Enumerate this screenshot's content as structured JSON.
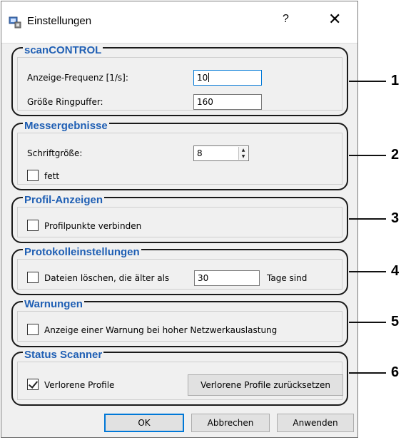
{
  "window": {
    "title": "Einstellungen",
    "help_label": "?",
    "close_label": "✕"
  },
  "groups": {
    "scancontrol": {
      "title": "scanCONTROL",
      "frequency_label": "Anzeige-Frequenz [1/s]:",
      "frequency_value": "10",
      "buffer_label": "Größe Ringpuffer:",
      "buffer_value": "160"
    },
    "messergebnisse": {
      "title": "Messergebnisse",
      "fontsize_label": "Schriftgröße:",
      "fontsize_value": "8",
      "bold_label": "fett",
      "bold_checked": false
    },
    "profil": {
      "title": "Profil-Anzeigen",
      "connect_label": "Profilpunkte verbinden",
      "connect_checked": false
    },
    "protokoll": {
      "title": "Protokolleinstellungen",
      "delete_label": "Dateien löschen, die älter als",
      "days_value": "30",
      "days_suffix": "Tage sind",
      "delete_checked": false
    },
    "warnungen": {
      "title": "Warnungen",
      "warn_label": "Anzeige einer Warnung bei hoher Netzwerkauslastung",
      "warn_checked": false
    },
    "status": {
      "title": "Status Scanner",
      "lost_label": "Verlorene Profile",
      "lost_checked": true,
      "reset_label": "Verlorene Profile zurücksetzen"
    }
  },
  "buttons": {
    "ok": "OK",
    "cancel": "Abbrechen",
    "apply": "Anwenden"
  },
  "callouts": [
    "1",
    "2",
    "3",
    "4",
    "5",
    "6"
  ],
  "icons": {
    "app": "settings-app-icon",
    "spin": "spin-arrows-icon",
    "check": "checkmark-icon"
  },
  "colors": {
    "group_title": "#1f5fb4",
    "focus_border": "#0078d7",
    "window_bg": "#f0f0f0"
  }
}
